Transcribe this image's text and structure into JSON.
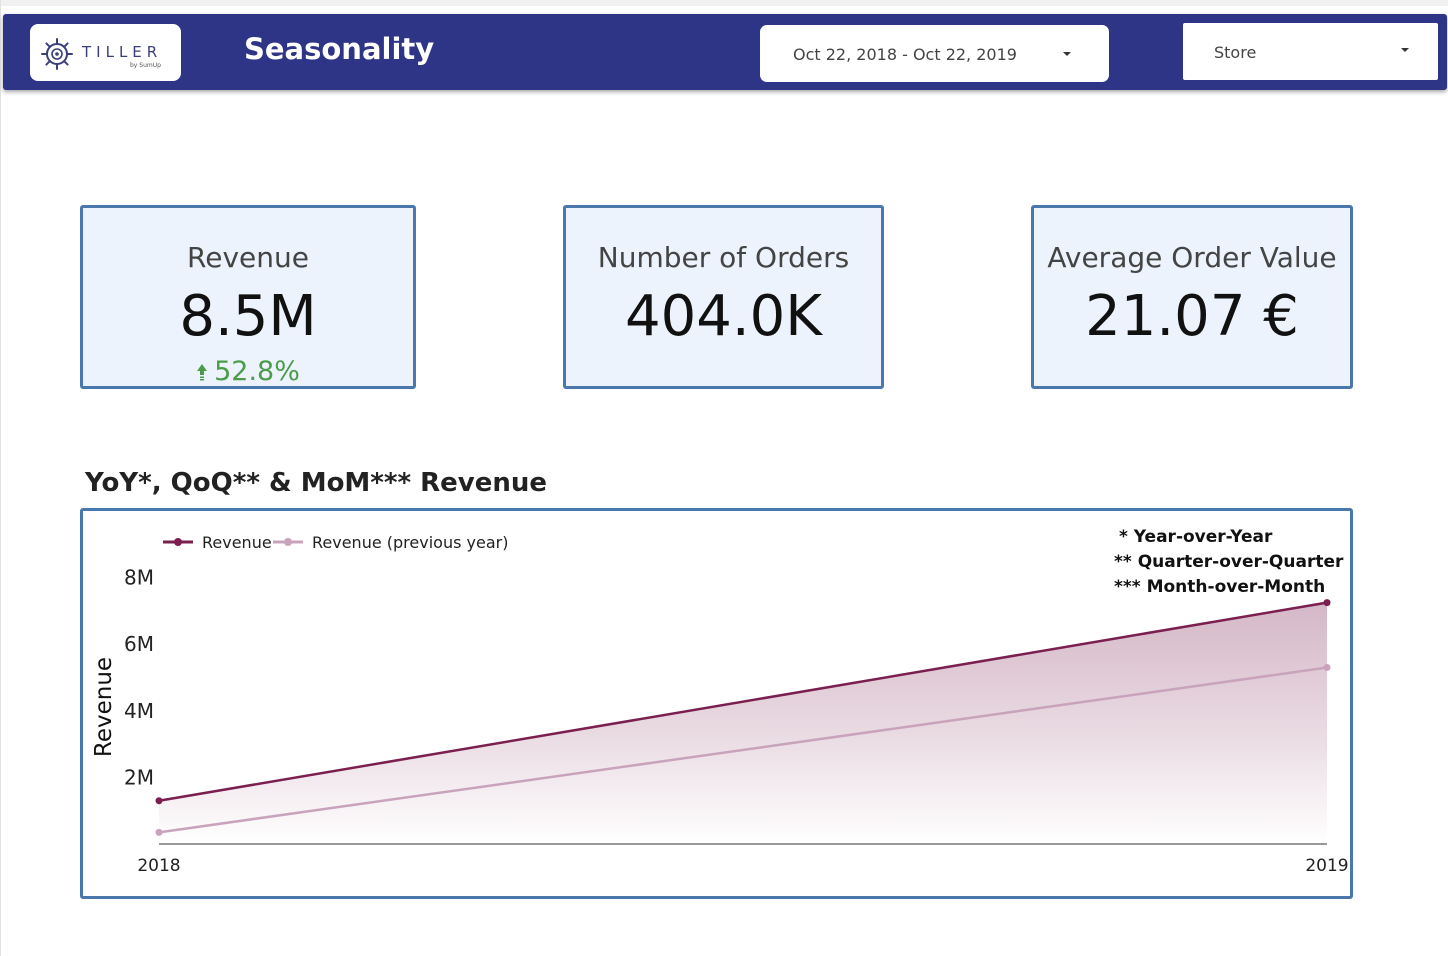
{
  "header": {
    "logo_text": "TILLER",
    "logo_sub": "by SumUp",
    "title": "Seasonality",
    "date_range": "Oct 22, 2018 - Oct 22, 2019",
    "store_label": "Store",
    "bg_color": "#2f3586"
  },
  "kpis": [
    {
      "label": "Revenue",
      "value": "8.5M",
      "delta": "52.8%"
    },
    {
      "label": "Number of Orders",
      "value": "404.0K"
    },
    {
      "label": "Average Order Value",
      "value": "21.07 €"
    }
  ],
  "chart": {
    "title": "YoY*, QoQ** & MoM*** Revenue",
    "notes": [
      "* Year-over-Year",
      "** Quarter-over-Quarter",
      "*** Month-over-Month"
    ]
  },
  "chart_data": {
    "type": "line",
    "x": [
      "2018",
      "2019"
    ],
    "series": [
      {
        "name": "Revenue",
        "values": [
          1300000,
          7250000
        ],
        "color": "#7a1f4f"
      },
      {
        "name": "Revenue (previous year)",
        "values": [
          350000,
          5300000
        ],
        "color": "#c9a3bc"
      }
    ],
    "ylabel": "Revenue",
    "yticks": [
      "2M",
      "4M",
      "6M",
      "8M"
    ],
    "ytick_values": [
      2000000,
      4000000,
      6000000,
      8000000
    ],
    "ylim": [
      0,
      8800000
    ],
    "legend": "top-left",
    "grid": false
  }
}
